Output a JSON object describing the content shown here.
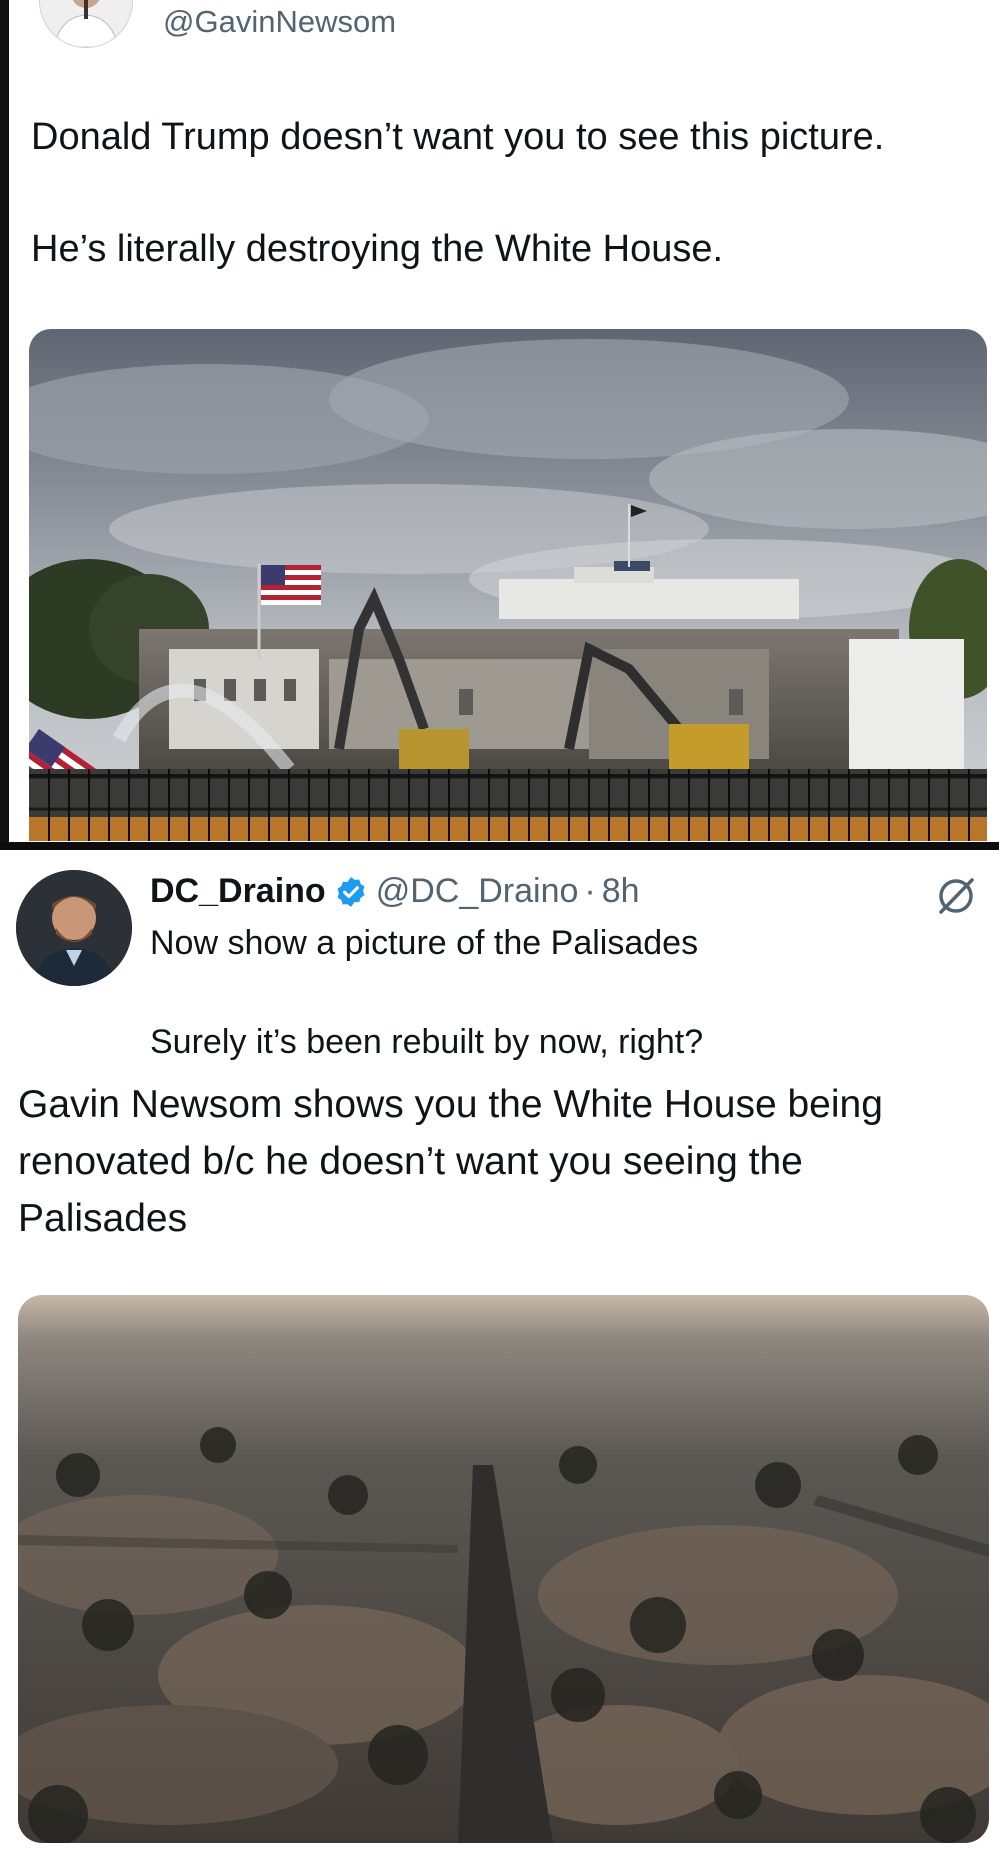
{
  "original_tweet": {
    "handle": "@GavinNewsom",
    "text_line_1": "Donald Trump doesn’t want you to see this picture.",
    "text_line_2": "He’s literally destroying the White House.",
    "avatar_icon": "user-avatar-icon",
    "image_icon": "white-house-demolition-photo"
  },
  "reply_tweet": {
    "display_name": "DC_Draino",
    "verified_icon": "verified-badge-icon",
    "verified_color": "#1d9bf0",
    "handle": "@DC_Draino",
    "separator": "·",
    "time": "8h",
    "grok_icon": "grok-icon",
    "text_line_1": "Now show a picture of the Palisades",
    "text_line_2": "Surely it’s been rebuilt by now, right?",
    "image_icon": "burned-neighborhood-aerial-photo"
  },
  "caption": "Gavin Newsom shows you the White House being renovated b/c he doesn’t want you seeing the Palisades"
}
